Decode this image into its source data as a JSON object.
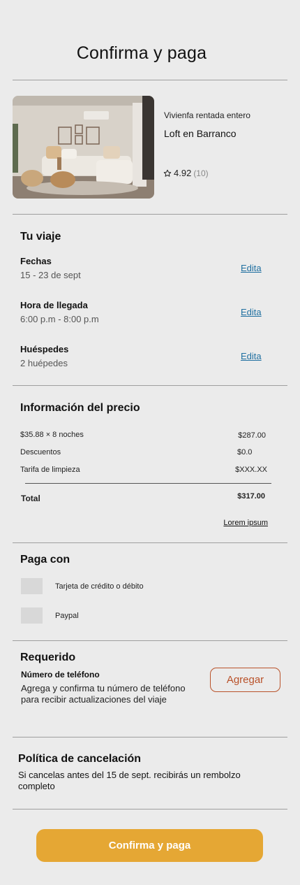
{
  "header": {
    "title": "Confirma y paga"
  },
  "listing": {
    "type": "Vivienfa rentada entero",
    "name": "Loft en Barranco",
    "rating": "4.92",
    "reviews": "(10)",
    "star_icon": "star-outline-icon"
  },
  "trip": {
    "title": "Tu viaje",
    "rows": [
      {
        "label": "Fechas",
        "value": "15 - 23 de sept",
        "action": "Edita"
      },
      {
        "label": "Hora de llegada",
        "value": "6:00 p.m - 8:00 p.m",
        "action": "Edita"
      },
      {
        "label": "Huéspedes",
        "value": "2 huépedes",
        "action": "Edita"
      }
    ]
  },
  "price": {
    "title": "Información del precio",
    "lines": [
      {
        "label": "$35.88 × 8 noches",
        "value": "$287.00"
      },
      {
        "label": "Descuentos",
        "value": "$0.0"
      },
      {
        "label": "Tarifa de limpieza",
        "value": "$XXX.XX"
      }
    ],
    "total_label": "Total",
    "total_value": "$317.00",
    "link": "Lorem ipsum"
  },
  "payment": {
    "title": "Paga con",
    "options": [
      {
        "label": "Tarjeta de crédito o débito"
      },
      {
        "label": "Paypal"
      }
    ]
  },
  "required": {
    "title": "Requerido",
    "field_label": "Número de teléfono",
    "description": "Agrega y confirma tu número de teléfono para recibir actualizaciones del viaje",
    "button": "Agregar"
  },
  "cancellation": {
    "title": "Política de cancelación",
    "text": "Si cancelas antes del 15 de sept. recibirás un rembolzo completo"
  },
  "footer": {
    "cta": "Confirma y paga"
  },
  "colors": {
    "background": "#ebebeb",
    "link": "#1f6fa0",
    "cta": "#e5a734",
    "accent_outline": "#b9522a"
  }
}
